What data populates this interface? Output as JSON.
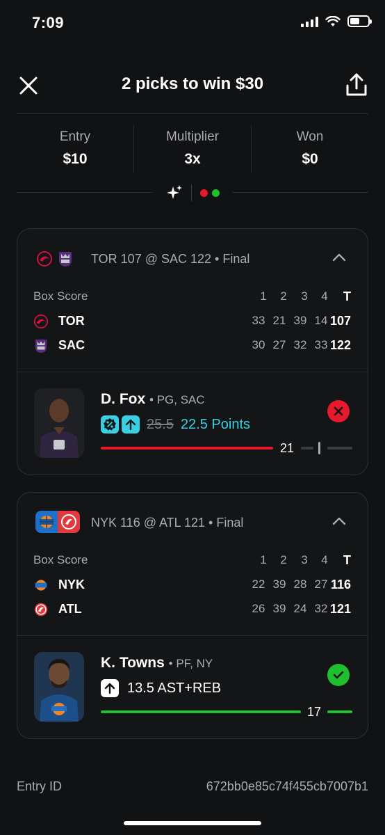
{
  "status_bar": {
    "time": "7:09"
  },
  "header": {
    "title": "2 picks to win $30"
  },
  "stats": [
    {
      "label": "Entry",
      "value": "$10"
    },
    {
      "label": "Multiplier",
      "value": "3x"
    },
    {
      "label": "Won",
      "value": "$0"
    }
  ],
  "games": [
    {
      "matchup": "TOR 107 @ SAC 122",
      "status": "Final",
      "box_score": {
        "label": "Box Score",
        "quarters": [
          "1",
          "2",
          "3",
          "4"
        ],
        "total_label": "T",
        "teams": [
          {
            "abbr": "TOR",
            "quarters": [
              "33",
              "21",
              "39",
              "14"
            ],
            "total": "107",
            "color": "#ce1141"
          },
          {
            "abbr": "SAC",
            "quarters": [
              "30",
              "27",
              "32",
              "33"
            ],
            "total": "122",
            "color": "#5a2d81"
          }
        ]
      },
      "pick": {
        "player": "D. Fox",
        "meta": "PG, SAC",
        "original_line": "25.5",
        "line": "22.5 Points",
        "actual": "21",
        "progress": 0.8,
        "result": "loss"
      }
    },
    {
      "matchup": "NYK 116 @ ATL 121",
      "status": "Final",
      "box_score": {
        "label": "Box Score",
        "quarters": [
          "1",
          "2",
          "3",
          "4"
        ],
        "total_label": "T",
        "teams": [
          {
            "abbr": "NYK",
            "quarters": [
              "22",
              "39",
              "28",
              "27"
            ],
            "total": "116",
            "color": "#006bb6"
          },
          {
            "abbr": "ATL",
            "quarters": [
              "26",
              "39",
              "24",
              "32"
            ],
            "total": "121",
            "color": "#e03a3e"
          }
        ]
      },
      "pick": {
        "player": "K. Towns",
        "meta": "PF, NY",
        "line": "13.5 AST+REB",
        "actual": "17",
        "progress": 1.0,
        "result": "win"
      }
    }
  ],
  "footer": {
    "entry_label": "Entry ID",
    "entry_id": "672bb0e85c74f455cb7007b1"
  },
  "colors": {
    "loss": "#e8192c",
    "win": "#1fbf2f",
    "accent": "#39d0e6"
  }
}
